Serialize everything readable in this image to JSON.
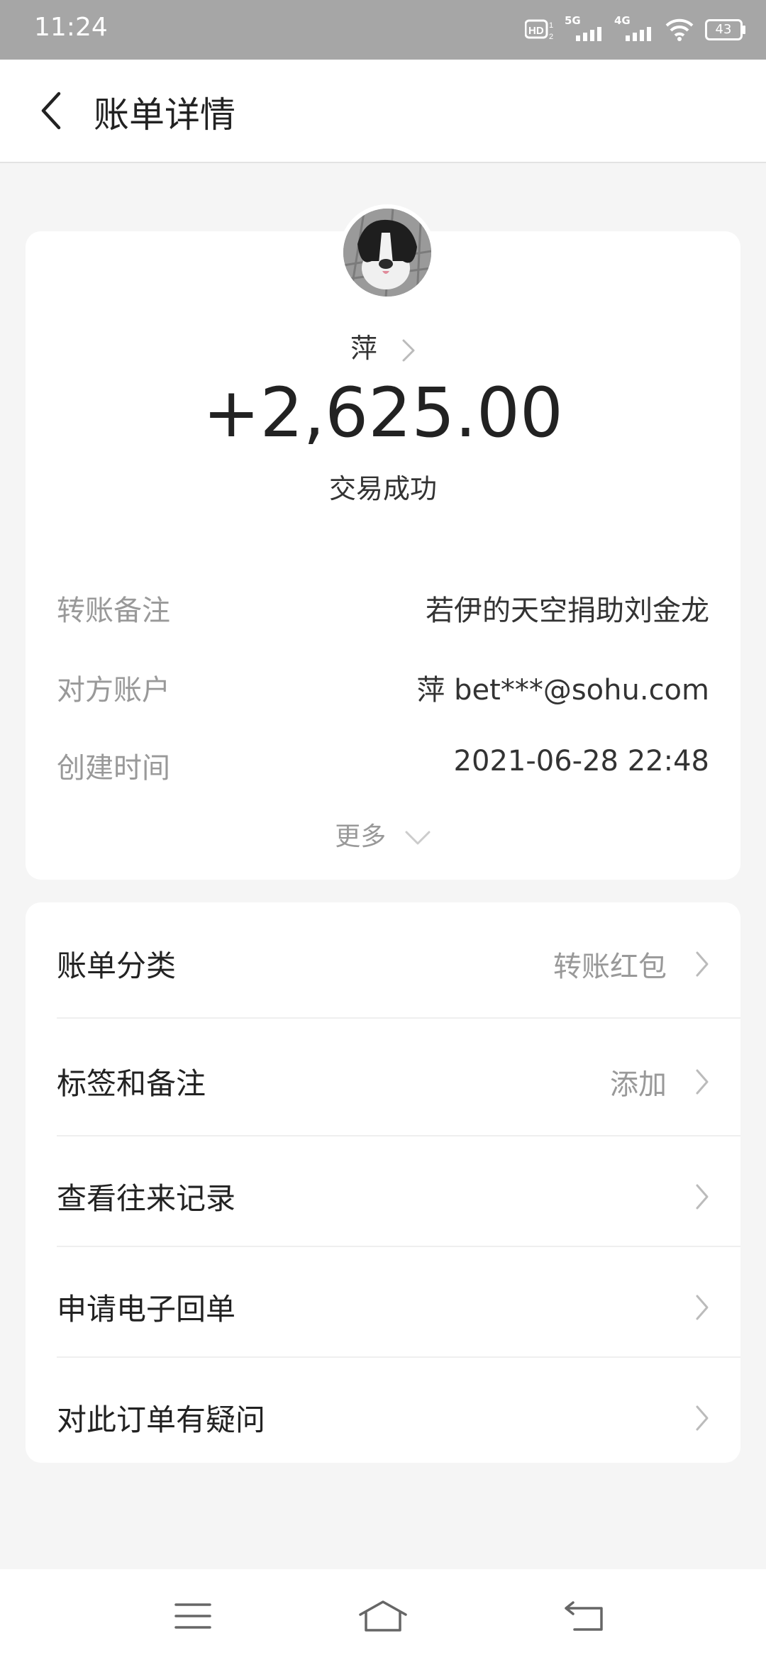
{
  "status_bar": {
    "time": "11:24",
    "network_1": "5G",
    "network_2": "4G",
    "battery": "43"
  },
  "header": {
    "title": "账单详情"
  },
  "summary": {
    "payer_name": "萍",
    "amount": "+2,625.00",
    "status": "交易成功",
    "avatar_icon": "dog-photo-avatar"
  },
  "details": [
    {
      "label": "转账备注",
      "value": "若伊的天空捐助刘金龙"
    },
    {
      "label": "对方账户",
      "value": "萍 bet***@sohu.com"
    },
    {
      "label": "创建时间",
      "value": "2021-06-28 22:48"
    }
  ],
  "more_label": "更多",
  "menu": [
    {
      "label": "账单分类",
      "value": "转账红包"
    },
    {
      "label": "标签和备注",
      "value": "添加"
    },
    {
      "label": "查看往来记录",
      "value": ""
    },
    {
      "label": "申请电子回单",
      "value": ""
    },
    {
      "label": "对此订单有疑问",
      "value": ""
    }
  ],
  "colors": {
    "status_bar_bg": "#a6a6a6",
    "page_bg": "#f5f5f5",
    "card_bg": "#ffffff",
    "muted_text": "#999999"
  }
}
